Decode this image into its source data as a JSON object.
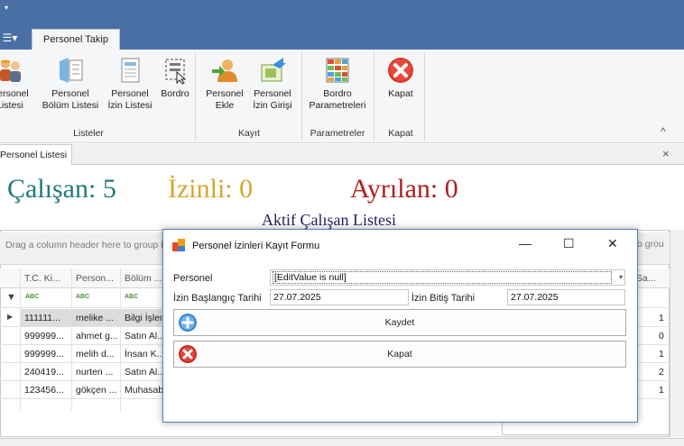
{
  "app": {
    "qat_arrow": "▾",
    "app_menu_icon": "☰▾"
  },
  "ribbon": {
    "tab_label": "Personel Takip",
    "buttons": [
      {
        "label1": "Personel",
        "label2": "Listesi"
      },
      {
        "label1": "Personel",
        "label2": "Bölüm Listesi"
      },
      {
        "label1": "Personel",
        "label2": "İzin Listesi"
      },
      {
        "label1": "Bordro",
        "label2": ""
      },
      {
        "label1": "Personel",
        "label2": "Ekle"
      },
      {
        "label1": "Personel",
        "label2": "İzin Girişi"
      },
      {
        "label1": "Bordro",
        "label2": "Parametreleri"
      },
      {
        "label1": "Kapat",
        "label2": ""
      }
    ],
    "groups": [
      "Listeler",
      "Kayıt",
      "Parametreler",
      "Kapat"
    ],
    "collapse_glyph": "^"
  },
  "document_tab": {
    "label": "Personel Listesi",
    "close_glyph": "×"
  },
  "stats": {
    "calisan": "Çalışan: 5",
    "izinli": "İzinli: 0",
    "ayrilan": "Ayrılan: 0",
    "colors": {
      "calisan": "#1f7b7b",
      "izinli": "#d4a72c",
      "ayrilan": "#b01e1e"
    }
  },
  "grid": {
    "group_hint": "Drag a column header here to group by that column",
    "group_hint_right": "o grou",
    "columns": [
      "T.C. Ki...",
      "Person...",
      "Bölüm ..."
    ],
    "right_column": "Sa...",
    "filter_glyph": "ABC",
    "rows": [
      {
        "tc": "111111...",
        "ad": "melike ...",
        "bolum": "Bilgi İşlem",
        "sa": "1",
        "current": true
      },
      {
        "tc": "999999...",
        "ad": "ahmet g...",
        "bolum": "Satın Al...",
        "sa": "0"
      },
      {
        "tc": "999999...",
        "ad": "melih d...",
        "bolum": "İnsan K...",
        "sa": "1"
      },
      {
        "tc": "240419...",
        "ad": "nurten ...",
        "bolum": "Satın Al...",
        "sa": "2"
      },
      {
        "tc": "123456...",
        "ad": "gökçen ...",
        "bolum": "Muhasabe",
        "sa": "1"
      }
    ]
  },
  "list_title": "Aktif Çalışan Listesi",
  "dialog": {
    "title": "Personel İzinleri Kayıt Formu",
    "minimize": "—",
    "maximize": "☐",
    "close": "✕",
    "personel_label": "Personel",
    "personel_value": "[EditValue is null]",
    "start_label": "İzin Başlangıç Tarihi",
    "start_value": "27.07.2025",
    "end_label": "İzin Bitiş Tarihi",
    "end_value": "27.07.2025",
    "save_label": "Kaydet",
    "close_label": "Kapat"
  }
}
